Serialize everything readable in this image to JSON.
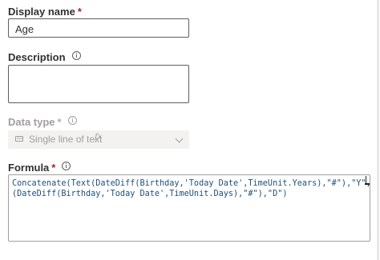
{
  "fields": {
    "display_name": {
      "label": "Display name",
      "required_mark": "*",
      "value": "Age"
    },
    "description": {
      "label": "Description",
      "value": ""
    },
    "data_type": {
      "label": "Data type",
      "required_mark": "*",
      "selected": "Single line of text",
      "disabled": true,
      "icon": "text-field-icon",
      "secondary_icon": "fx-icon"
    },
    "formula": {
      "label": "Formula",
      "required_mark": "*",
      "line1": "Concatenate(Text(DateDiff(Birthday,'Today Date',TimeUnit.Years),\"#\"),\"Y\",Text",
      "line2": "(DateDiff(Birthday,'Today Date',TimeUnit.Days),\"#\"),\"D\")"
    }
  },
  "colors": {
    "required": "#a4262c",
    "formula_text": "#1f4e79",
    "disabled_text": "#a19f9d"
  }
}
